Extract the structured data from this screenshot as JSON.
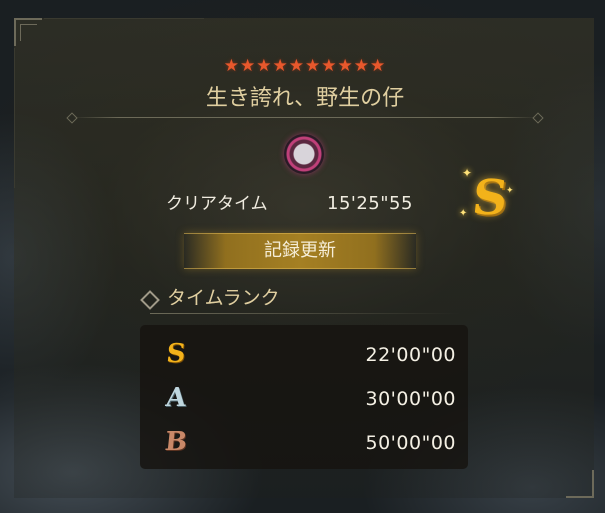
{
  "quest": {
    "stars": "★★★★★★★★★★",
    "title": "生き誇れ、野生の仔"
  },
  "result": {
    "clear_label": "クリアタイム",
    "clear_time": "15'25\"55",
    "rank": "S",
    "record_label": "記録更新"
  },
  "time_rank": {
    "title": "タイムランク",
    "rows": [
      {
        "rank": "S",
        "time": "22'00\"00",
        "color": "#f3b21a"
      },
      {
        "rank": "A",
        "time": "30'00\"00",
        "color": "#bfd6de"
      },
      {
        "rank": "B",
        "time": "50'00\"00",
        "color": "#c98868"
      }
    ]
  },
  "colors": {
    "star": "#e8582c",
    "title_text": "#e0cfa0",
    "banner_gold": "#a5802a",
    "rank_s": "#f3b21a"
  },
  "icons": {
    "monster": "monster-portrait-icon",
    "section": "diamond-emblem-icon"
  }
}
